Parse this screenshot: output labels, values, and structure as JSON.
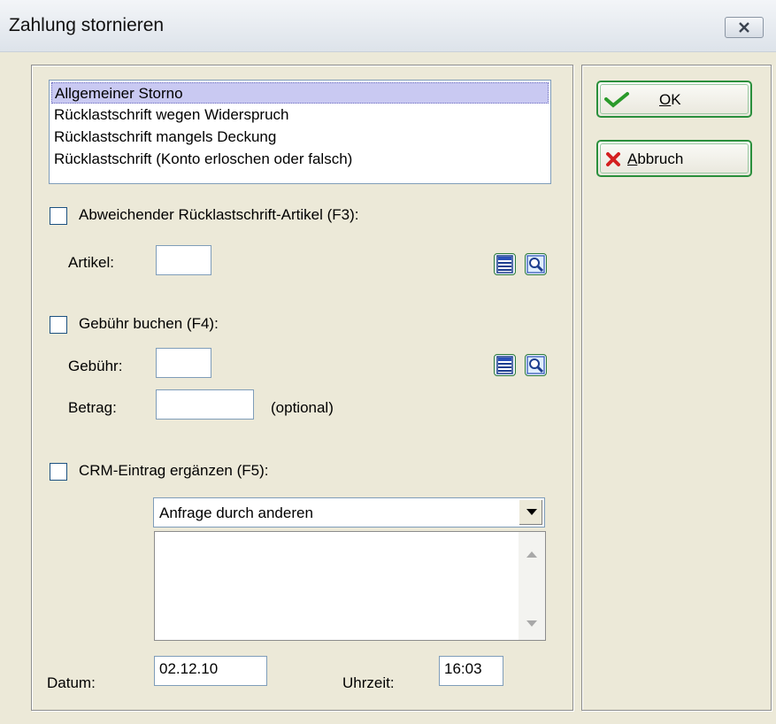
{
  "window": {
    "title": "Zahlung stornieren"
  },
  "reasons": {
    "items": [
      "Allgemeiner Storno",
      "Rücklastschrift wegen Widerspruch",
      "Rücklastschrift mangels Deckung",
      "Rücklastschrift (Konto erloschen oder falsch)"
    ],
    "selected_index": 0
  },
  "article_section": {
    "checkbox_label": "Abweichender Rücklastschrift-Artikel (F3):",
    "checked": false,
    "artikel_label": "Artikel:",
    "artikel_value": ""
  },
  "fee_section": {
    "checkbox_label": "Gebühr buchen (F4):",
    "checked": false,
    "gebuehr_label": "Gebühr:",
    "gebuehr_value": "",
    "betrag_label": "Betrag:",
    "betrag_value": "",
    "optional_label": "(optional)"
  },
  "crm_section": {
    "checkbox_label": "CRM-Eintrag ergänzen (F5):",
    "checked": false,
    "type_selected": "Anfrage durch anderen",
    "memo_text": ""
  },
  "datetime": {
    "datum_label": "Datum:",
    "datum_value": "02.12.10",
    "uhrzeit_label": "Uhrzeit:",
    "uhrzeit_value": "16:03"
  },
  "buttons": {
    "ok_mnemonic": "O",
    "ok_rest": "K",
    "cancel_mnemonic": "A",
    "cancel_rest": "bbruch"
  },
  "icons": {
    "ok": "checkmark-icon",
    "cancel": "red-x-icon",
    "list": "list-icon",
    "search": "magnifier-icon",
    "close": "close-icon"
  },
  "colors": {
    "selection": "#c9c9f2",
    "button_border": "#2a8f3c",
    "check_green": "#2a9a2a",
    "cancel_red": "#d42020"
  }
}
